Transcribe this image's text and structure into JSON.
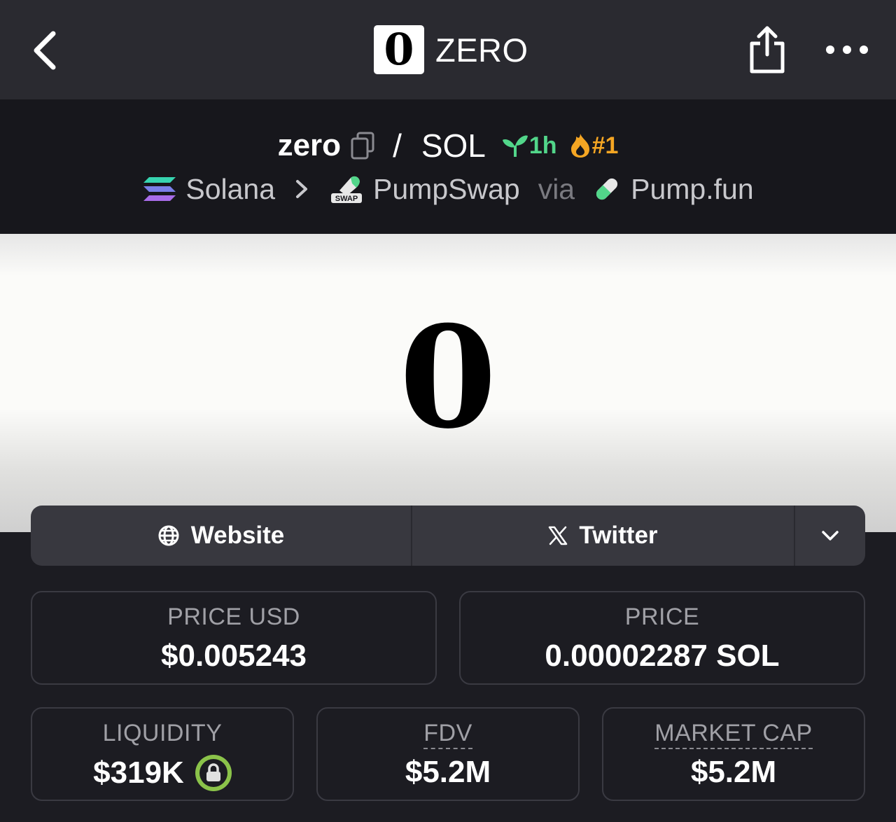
{
  "topbar": {
    "brand_logo_text": "0",
    "brand_name": "ZERO"
  },
  "pair": {
    "base": "zero",
    "separator": "/",
    "quote": "SOL",
    "age": "1h",
    "rank": "#1",
    "age_color": "#52d68a",
    "rank_color": "#f5a623"
  },
  "route": {
    "chain": "Solana",
    "dex": "PumpSwap",
    "via": "via",
    "launchpad": "Pump.fun",
    "dex_badge": "SWAP"
  },
  "banner": {
    "glyph": "0"
  },
  "links": {
    "website": "Website",
    "twitter": "Twitter"
  },
  "stats": {
    "price_usd_label": "PRICE USD",
    "price_usd_value": "$0.005243",
    "price_label": "PRICE",
    "price_value": "0.00002287 SOL",
    "liquidity_label": "LIQUIDITY",
    "liquidity_value": "$319K",
    "fdv_label": "FDV",
    "fdv_value": "$5.2M",
    "mcap_label": "MARKET CAP",
    "mcap_value": "$5.2M"
  },
  "icons": {
    "back": "chevron-left-icon",
    "share": "share-icon",
    "more": "more-horizontal-icon",
    "copy": "copy-icon",
    "age": "seedling-icon",
    "rank": "flame-icon",
    "chain": "solana-icon",
    "separator": "chevron-right-icon",
    "dex": "pumpswap-icon",
    "launchpad": "pill-icon",
    "website": "globe-icon",
    "twitter": "x-logo-icon",
    "expand": "chevron-down-icon",
    "lock": "lock-icon"
  }
}
